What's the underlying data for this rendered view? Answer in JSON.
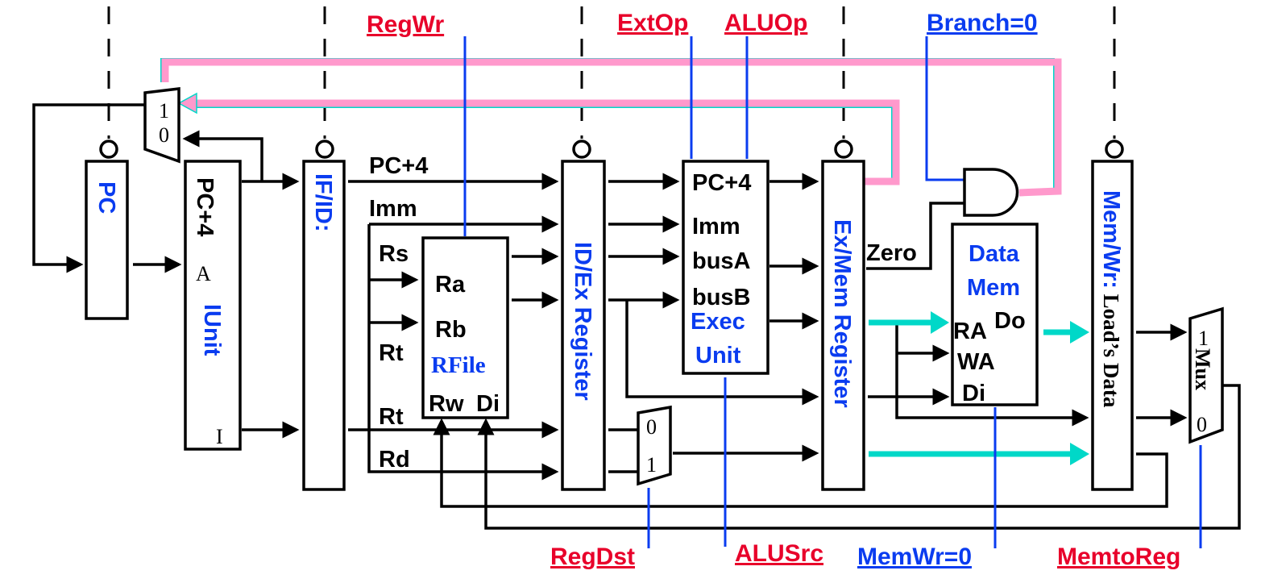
{
  "colors": {
    "control_red": "#e8002a",
    "control_blue": "#0a3cf0",
    "highlight_pink": "#ff99cc",
    "highlight_cyan": "#00d8c8"
  },
  "controls_top": {
    "regwr": "RegWr",
    "extop": "ExtOp",
    "aluop": "ALUOp",
    "branch": "Branch=0"
  },
  "controls_bottom": {
    "regdst": "RegDst",
    "alusrc": "ALUSrc",
    "memwr": "MemWr=0",
    "memtoreg": "MemtoReg"
  },
  "pc": {
    "label": "PC"
  },
  "iunit": {
    "pc4": "PC+4",
    "a": "A",
    "label": "IUnit",
    "i": "I"
  },
  "ifid": {
    "label": "IF/ID:"
  },
  "pc_mux": {
    "in1": "1",
    "in0": "0"
  },
  "decode": {
    "pc4": "PC+4",
    "imm": "Imm",
    "rs": "Rs",
    "rt1": "Rt",
    "rt2": "Rt",
    "rd": "Rd"
  },
  "rfile": {
    "ra": "Ra",
    "rb": "Rb",
    "label": "RFile",
    "rw": "Rw",
    "di": "Di"
  },
  "idex": {
    "label": "ID/Ex Register"
  },
  "regdst_mux": {
    "in0": "0",
    "in1": "1"
  },
  "exec": {
    "pc4": "PC+4",
    "imm": "Imm",
    "busa": "busA",
    "busb": "busB",
    "label1": "Exec",
    "label2": "Unit"
  },
  "exmem": {
    "label": "Ex/Mem Register",
    "zero": "Zero"
  },
  "datamem": {
    "label1": "Data",
    "label2": "Mem",
    "ra": "RA",
    "do": "Do",
    "wa": "WA",
    "di": "Di"
  },
  "memwr": {
    "label1": "Mem/Wr:",
    "label2": " Load’s Data"
  },
  "wb_mux": {
    "in1": "1",
    "label": "Mux",
    "in0": "0"
  }
}
